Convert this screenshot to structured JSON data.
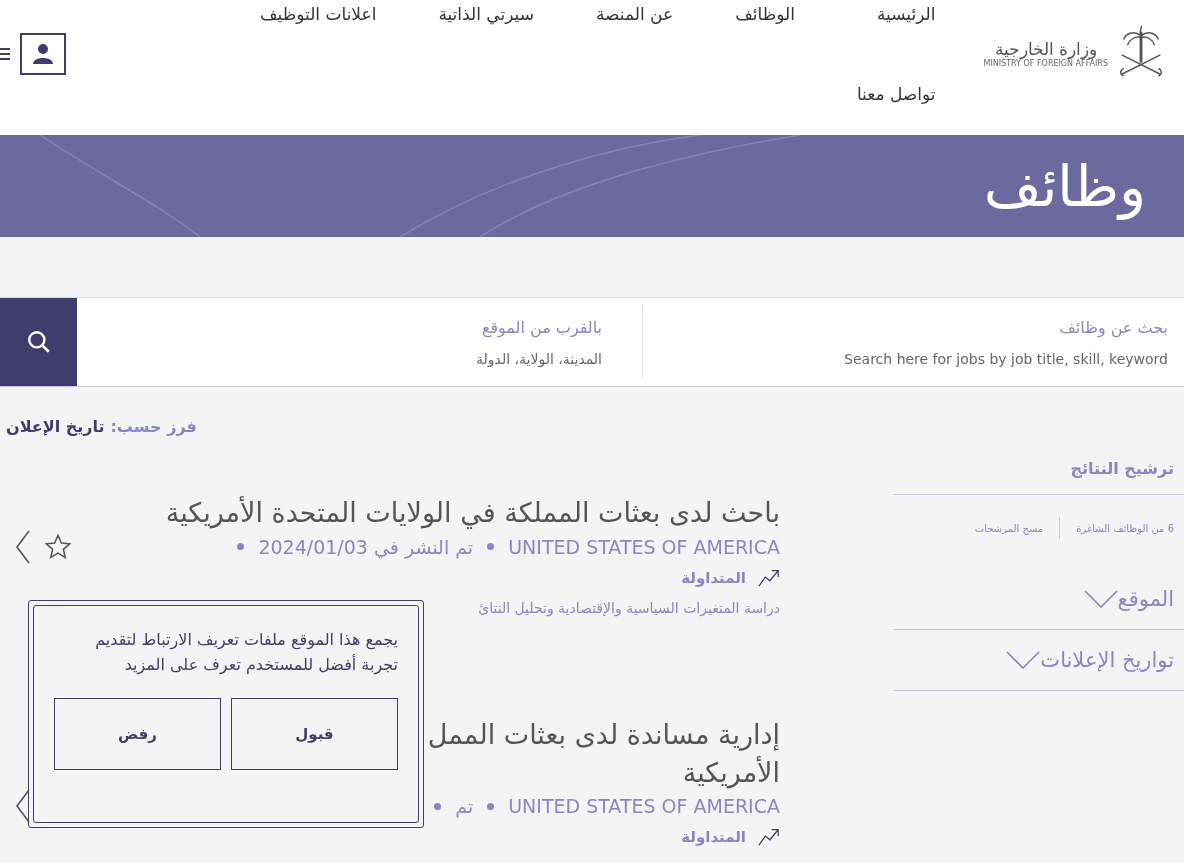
{
  "logo": {
    "arabic": "وزارة الخارجية",
    "english": "MINISTRY OF FOREIGN AFFAIRS"
  },
  "nav": [
    {
      "label": "الرئيسية"
    },
    {
      "label": "الوظائف"
    },
    {
      "label": "عن المنصة"
    },
    {
      "label": "سيرتي الذاتية"
    },
    {
      "label": "اعلانات التوظيف"
    },
    {
      "label": "تواصل معنا"
    }
  ],
  "banner": {
    "title": "وظائف"
  },
  "search": {
    "keyword": {
      "label": "بحث عن وظائف",
      "placeholder": "Search here for jobs by job title, skill, keyword"
    },
    "location": {
      "label": "بالقرب من الموقع",
      "placeholder": "المدينة، الولاية، الدولة"
    }
  },
  "sort": {
    "label": "فرز حسب:",
    "value": "تاريخ الإعلان"
  },
  "filters": {
    "title": "ترشيح النتائج",
    "count": "6 من الوظائف الشاغرة",
    "clear": "مسح المرشحات",
    "sections": [
      {
        "label": "الموقع",
        "expanded": false
      },
      {
        "label": "تواريخ الإعلانات",
        "expanded": false
      }
    ]
  },
  "jobs": [
    {
      "title_lines": [
        "باحث لدى بعثات المملكة في الولايات المتحدة الأمريكية"
      ],
      "country": "UNITED STATES OF AMERICA",
      "posted": "تم النشر في 2024/01/03",
      "tag": "المتداولة",
      "description": "دراسة المتغيرات السياسية والإقتصادية وتحليل النتائ"
    },
    {
      "title_lines": [
        "إدارية مساندة لدى بعثات الممل",
        "الأمريكية"
      ],
      "country": "UNITED STATES OF AMERICA",
      "posted": "تم",
      "tag": "المتداولة"
    }
  ],
  "cookie": {
    "message": "يجمع هذا الموقع ملفات تعريف الارتباط لتقديم تجربة أفضل للمستخدم تعرف على المزيد",
    "accept": "قبول",
    "reject": "رفض"
  }
}
